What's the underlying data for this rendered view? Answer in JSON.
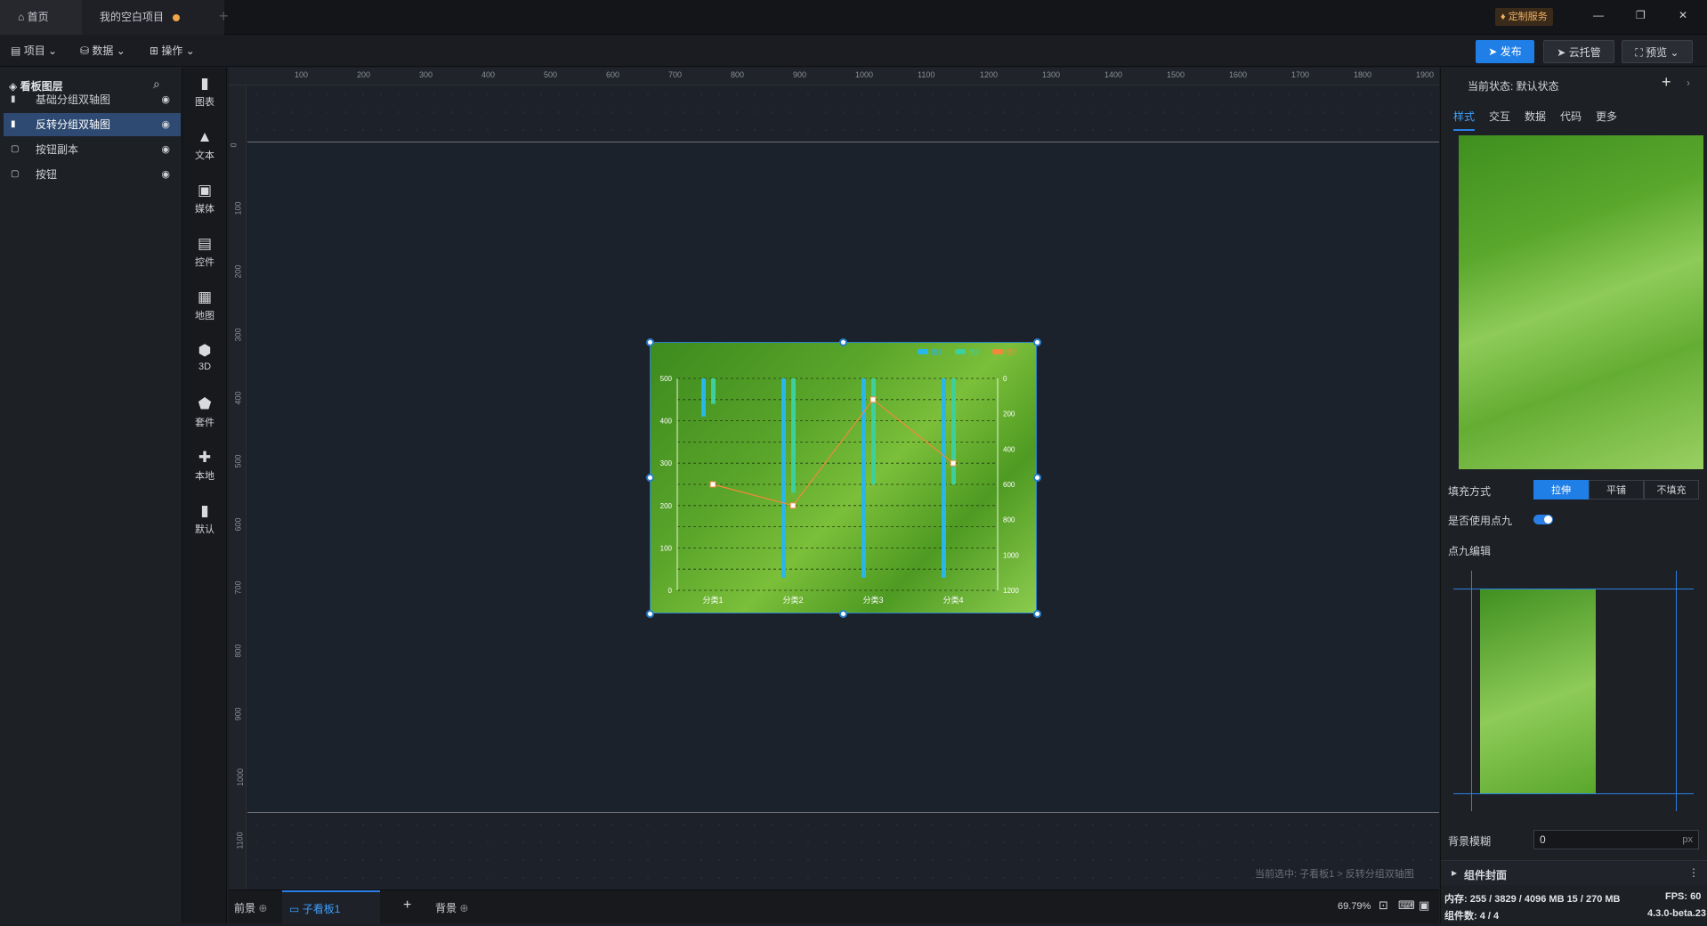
{
  "tabs": {
    "home": "首页",
    "project": "我的空白项目",
    "add": "+"
  },
  "titlebar": {
    "custom_service": "定制服务",
    "min": "—",
    "max": "❐",
    "close": "✕"
  },
  "menu": {
    "project": "项目",
    "data": "数据",
    "ops": "操作"
  },
  "actions": {
    "publish": "发布",
    "cloud": "云托管",
    "preview": "预览"
  },
  "layers": {
    "title": "看板图层",
    "items": [
      {
        "label": "基础分组双轴图",
        "selected": false
      },
      {
        "label": "反转分组双轴图",
        "selected": true
      },
      {
        "label": "按钮副本",
        "selected": false
      },
      {
        "label": "按钮",
        "selected": false
      }
    ]
  },
  "tools": [
    "图表",
    "文本",
    "媒体",
    "控件",
    "地图",
    "3D",
    "套件",
    "本地",
    "默认"
  ],
  "ruler_h": [
    "100",
    "200",
    "300",
    "400",
    "500",
    "600",
    "700",
    "800",
    "900",
    "1000",
    "1100",
    "1200",
    "1300",
    "1400",
    "1500",
    "1600",
    "1700",
    "1800",
    "1900"
  ],
  "ruler_v": [
    "0",
    "100",
    "200",
    "300",
    "400",
    "500",
    "600",
    "700",
    "800",
    "900",
    "1000",
    "1100"
  ],
  "chart_data": {
    "type": "bar",
    "categories": [
      "分类1",
      "分类2",
      "分类3",
      "分类4"
    ],
    "series": [
      {
        "name": "值1",
        "type": "bar",
        "axis": "left-inverted",
        "values": [
          90,
          470,
          470,
          470
        ],
        "color": "#29b6e8"
      },
      {
        "name": "值2",
        "type": "bar",
        "axis": "left-inverted",
        "values": [
          60,
          270,
          250,
          250
        ],
        "color": "#3ecf9a"
      },
      {
        "name": "值3",
        "type": "line",
        "axis": "left",
        "values": [
          250,
          200,
          450,
          300
        ],
        "color": "#f08a3a"
      }
    ],
    "ylim_left": [
      0,
      500
    ],
    "yticks_left": [
      "0",
      "100",
      "200",
      "300",
      "400",
      "500"
    ],
    "ylim_right": [
      0,
      1200
    ],
    "yticks_right": [
      "0",
      "200",
      "400",
      "600",
      "800",
      "1000",
      "1200"
    ],
    "grid": true,
    "legend": "top-right"
  },
  "bottom": {
    "foreground": "前景",
    "sub_board": "子看板1",
    "background": "背景",
    "hint": "当前选中: 子看板1 > 反转分组双轴图",
    "zoom": "69.79%"
  },
  "right": {
    "state_label": "当前状态: 默认状态",
    "tabs": [
      "样式",
      "交互",
      "数据",
      "代码",
      "更多"
    ],
    "fill_label": "填充方式",
    "fill_options": [
      "拉伸",
      "平铺",
      "不填充"
    ],
    "use_nine_label": "是否使用点九",
    "nine_edit_label": "点九编辑",
    "blur_label": "背景模糊",
    "blur_value": "0",
    "blur_unit": "px",
    "cover_label": "组件封面"
  },
  "status": {
    "memory": "内存: 255 / 3829 / 4096 MB 15 / 270 MB",
    "fps": "FPS: 60",
    "count": "组件数: 4 / 4",
    "version": "4.3.0-beta.23"
  }
}
